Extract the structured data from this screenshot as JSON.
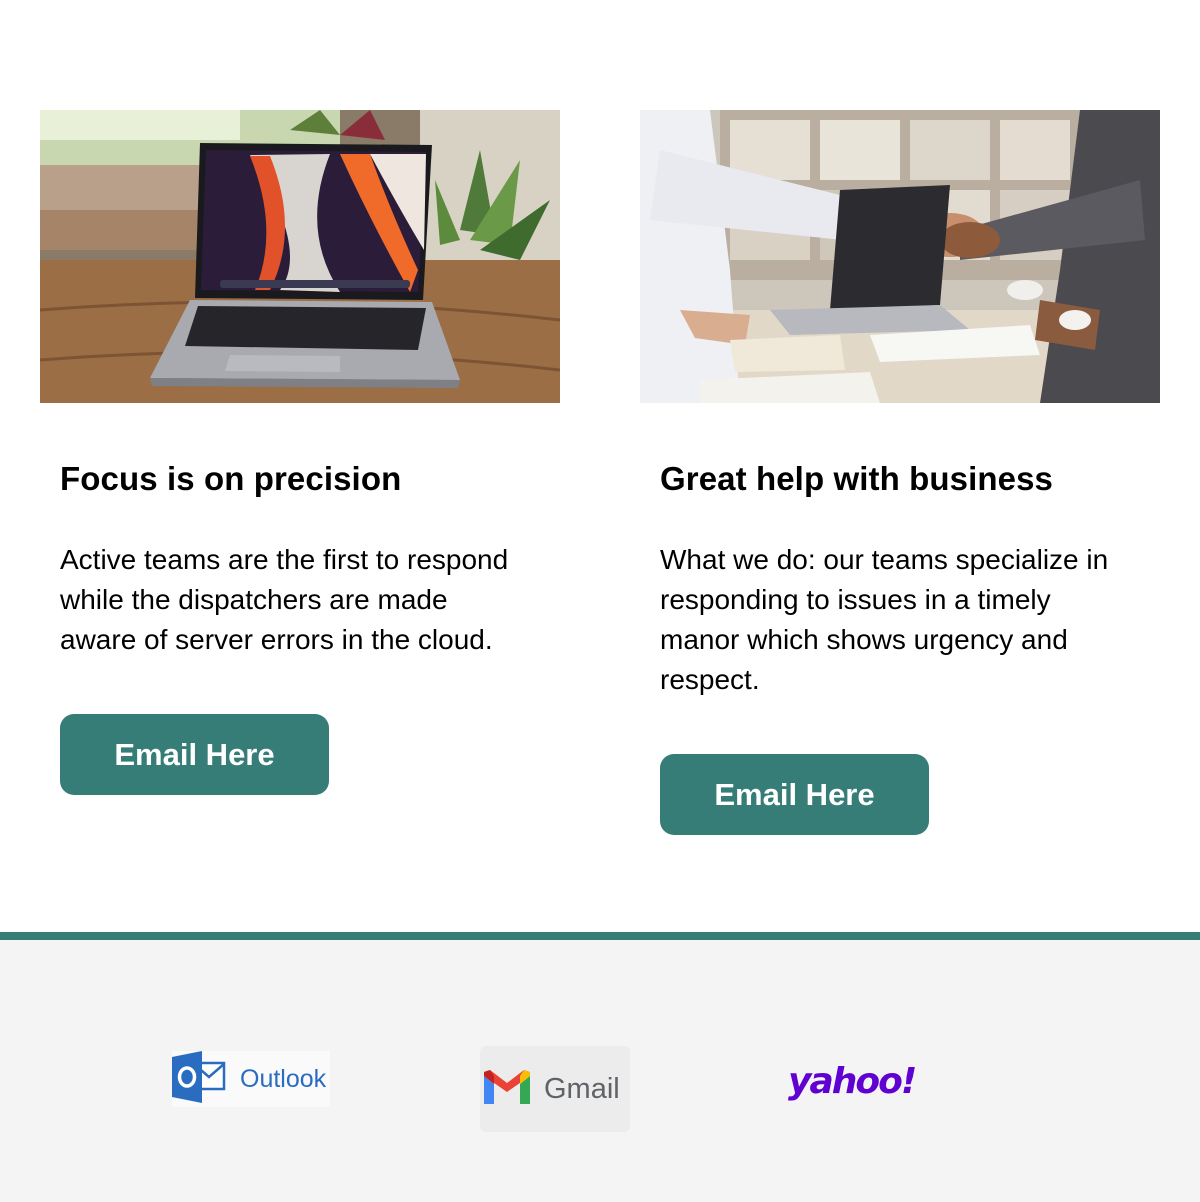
{
  "cards": [
    {
      "image_subject": "laptop on wooden table with plants by window",
      "title": "Focus is on precision",
      "text": "Active teams are the first to respond while the dispatchers are made aware of server errors in the cloud.",
      "button_label": "Email Here"
    },
    {
      "image_subject": "business handshake over desk with laptop and documents",
      "title": "Great help with business",
      "text": "What we do: our teams specialize in responding to issues in a timely manor which shows urgency and respect.",
      "button_label": "Email Here"
    }
  ],
  "footer": {
    "providers": [
      {
        "name": "Outlook",
        "icon": "outlook-icon"
      },
      {
        "name": "Gmail",
        "icon": "gmail-icon"
      },
      {
        "name": "yahoo!",
        "icon": "yahoo-logo"
      }
    ]
  },
  "colors": {
    "accent": "#367d78",
    "footer_bg": "#f4f4f4",
    "outlook_blue": "#2a6cc0",
    "yahoo_purple": "#6001d2"
  }
}
